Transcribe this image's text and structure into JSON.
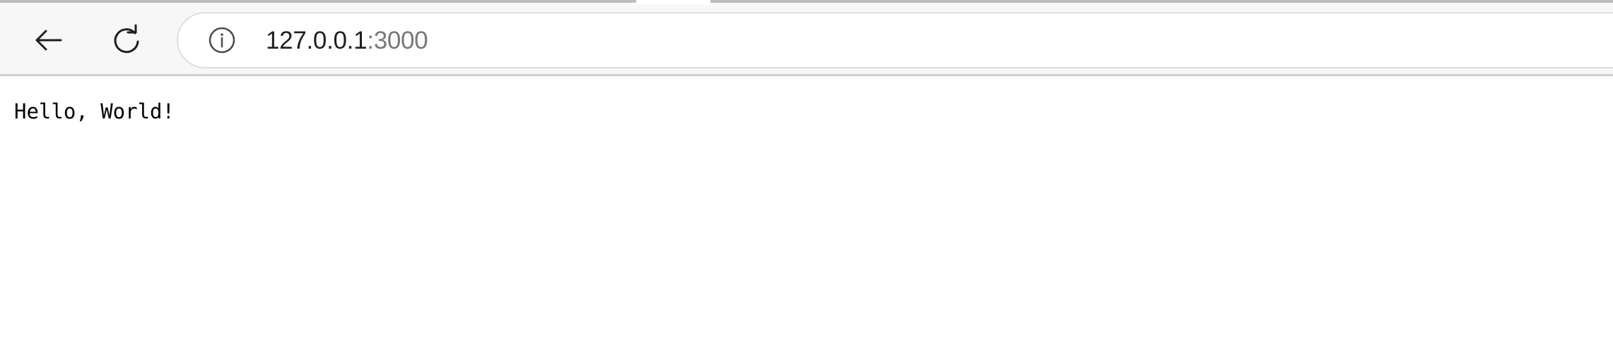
{
  "browser": {
    "address_bar": {
      "url_host": "127.0.0.1",
      "url_port": ":3000"
    },
    "icons": {
      "back": "back-arrow-icon",
      "reload": "reload-icon",
      "site_info": "info-icon"
    }
  },
  "page": {
    "body_text": "Hello, World!"
  }
}
